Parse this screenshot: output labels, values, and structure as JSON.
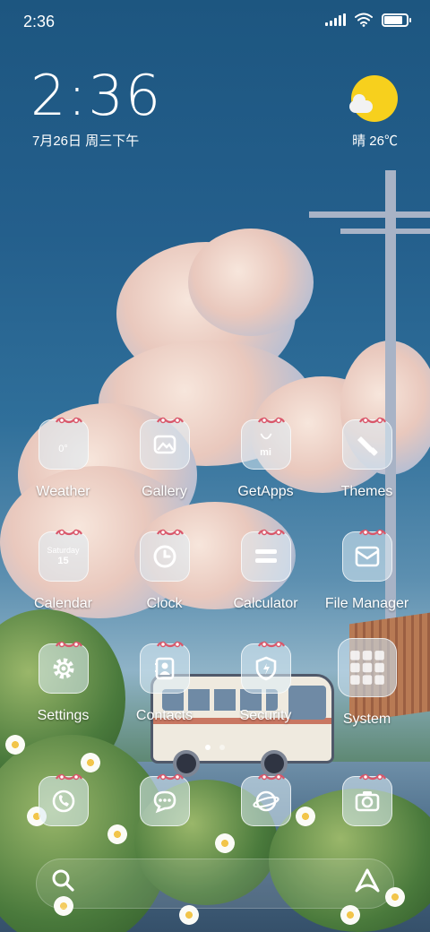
{
  "status_bar": {
    "time": "2:36",
    "battery_level": 0.85
  },
  "clock_widget": {
    "time": "2:36",
    "date": "7月26日 周三下午"
  },
  "weather_widget": {
    "text": "晴 26℃",
    "icon": "sunny-partly-cloudy-icon"
  },
  "apps": [
    {
      "label": "Weather",
      "icon": "weather-icon",
      "glyph_text": "0°"
    },
    {
      "label": "Gallery",
      "icon": "gallery-icon"
    },
    {
      "label": "GetApps",
      "icon": "getapps-icon",
      "glyph_text": "mi"
    },
    {
      "label": "Themes",
      "icon": "themes-brush-icon"
    },
    {
      "label": "Calendar",
      "icon": "calendar-icon",
      "glyph_text": "Saturday",
      "glyph_num": "15"
    },
    {
      "label": "Clock",
      "icon": "clock-icon"
    },
    {
      "label": "Calculator",
      "icon": "calculator-icon"
    },
    {
      "label": "File Manager",
      "icon": "folder-icon"
    },
    {
      "label": "Settings",
      "icon": "gear-icon"
    },
    {
      "label": "Contacts",
      "icon": "contacts-icon"
    },
    {
      "label": "Security",
      "icon": "shield-icon"
    },
    {
      "label": "System",
      "icon": "folder-grid-icon"
    }
  ],
  "dock": [
    {
      "icon": "phone-icon"
    },
    {
      "icon": "messages-icon"
    },
    {
      "icon": "browser-icon"
    },
    {
      "icon": "camera-icon"
    }
  ],
  "page_indicator": {
    "pages": 2,
    "current": 1
  },
  "search_bar": {
    "left_icon": "search-icon",
    "right_icon": "assistant-icon"
  },
  "colors": {
    "sun": "#f7d01d",
    "bow": "#d9576a",
    "icon_bg": "rgba(220,236,245,0.55)"
  }
}
